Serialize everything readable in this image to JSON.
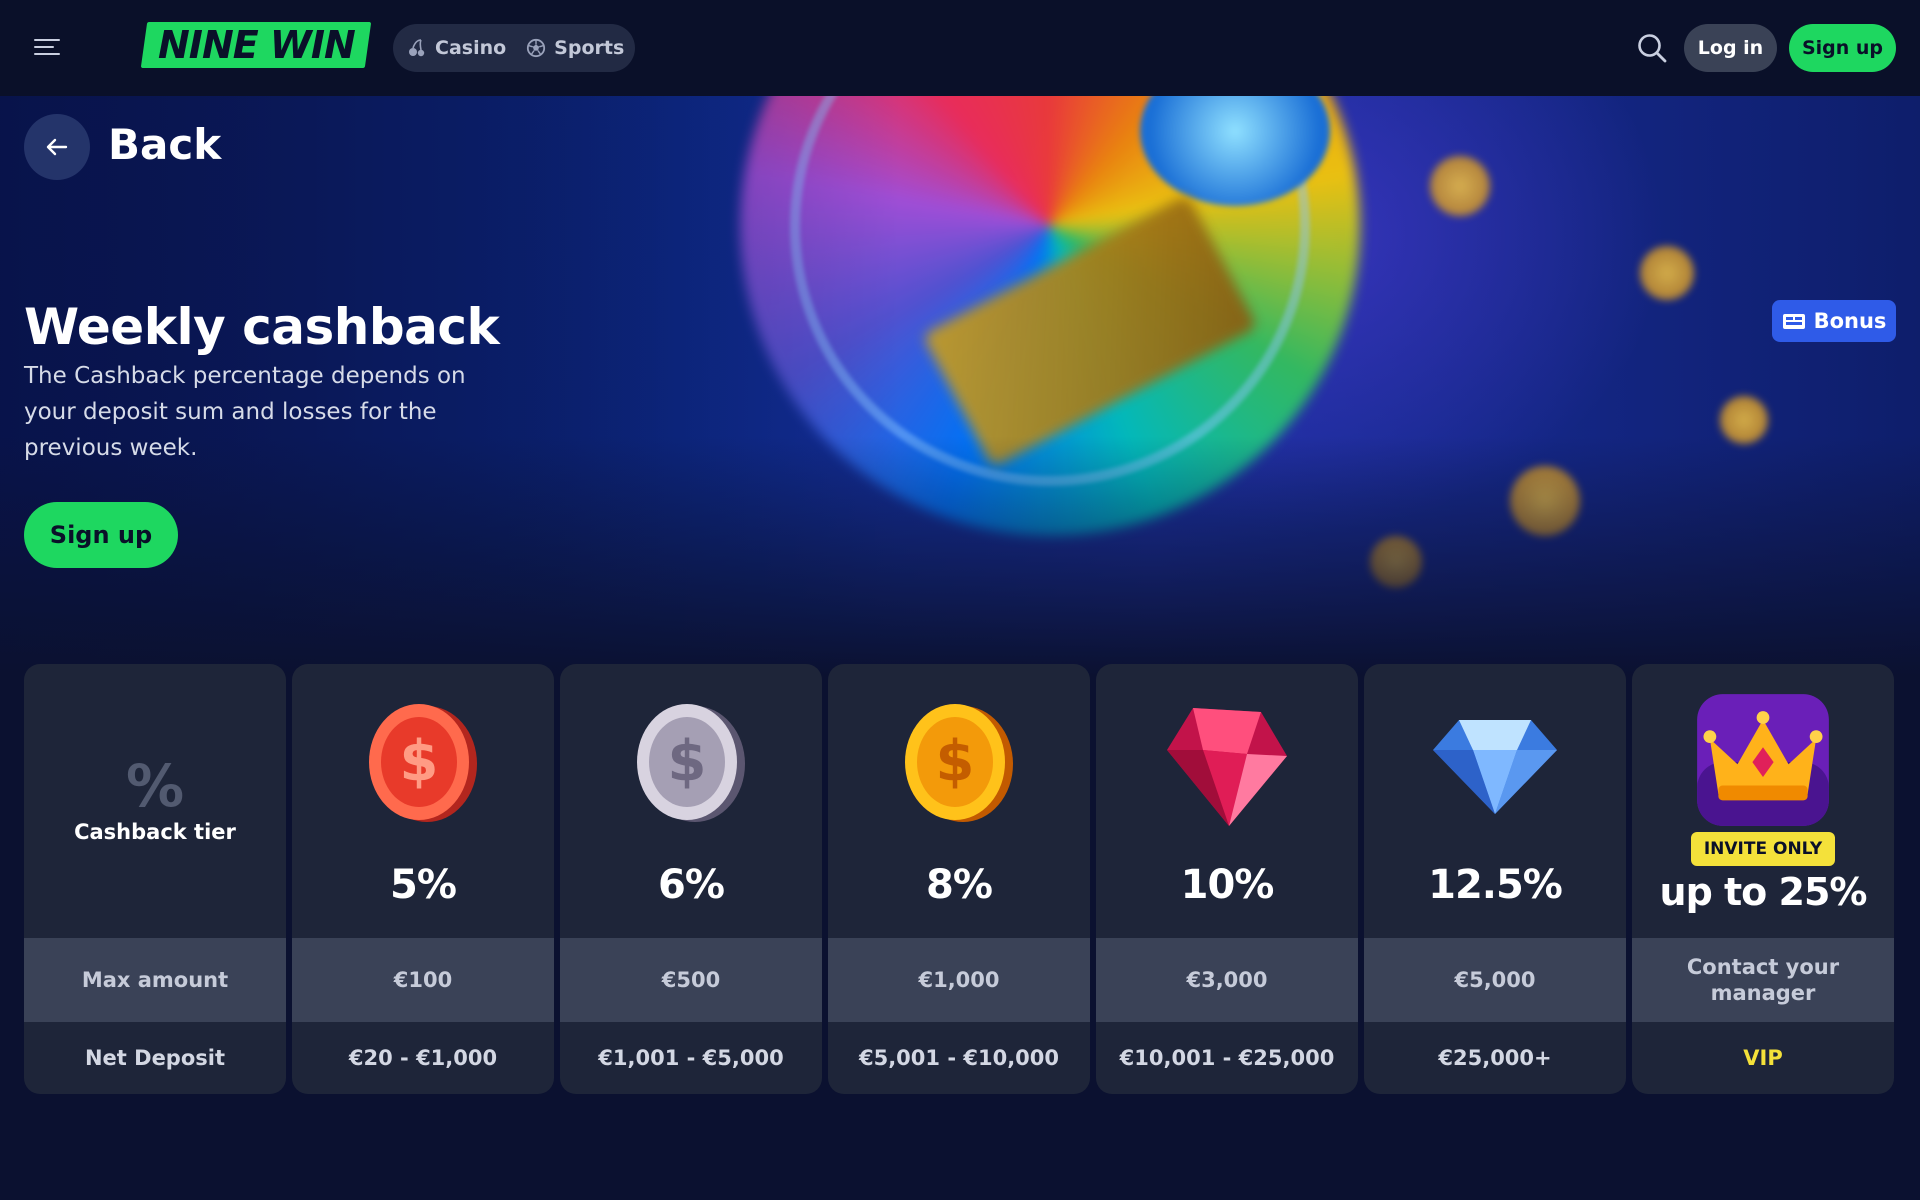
{
  "header": {
    "brand": "NINE WIN",
    "modes": [
      {
        "label": "Casino",
        "icon": "cherry-icon"
      },
      {
        "label": "Sports",
        "icon": "soccer-ball-icon"
      }
    ],
    "login_label": "Log in",
    "signup_label": "Sign up"
  },
  "hero": {
    "back_label": "Back",
    "title": "Weekly cashback",
    "description": "The Cashback percentage depends on your deposit sum and losses for the previous week.",
    "signup_label": "Sign up",
    "tag_label": "Bonus"
  },
  "tiers": {
    "header_label": "Cashback tier",
    "header_symbol": "%",
    "max_amount_label": "Max amount",
    "net_deposit_label": "Net Deposit",
    "items": [
      {
        "icon": "red-coin-icon",
        "percent": "5%",
        "max_amount": "€100",
        "net_deposit": "€20 - €1,000"
      },
      {
        "icon": "silver-coin-icon",
        "percent": "6%",
        "max_amount": "€500",
        "net_deposit": "€1,001 - €5,000"
      },
      {
        "icon": "gold-coin-icon",
        "percent": "8%",
        "max_amount": "€1,000",
        "net_deposit": "€5,001 - €10,000"
      },
      {
        "icon": "ruby-gem-icon",
        "percent": "10%",
        "max_amount": "€3,000",
        "net_deposit": "€10,001 - €25,000"
      },
      {
        "icon": "diamond-icon",
        "percent": "12.5%",
        "max_amount": "€5,000",
        "net_deposit": "€25,000+"
      },
      {
        "icon": "crown-icon",
        "badge": "INVITE ONLY",
        "percent": "up to 25%",
        "max_amount": "Contact your manager",
        "net_deposit": "VIP"
      }
    ]
  },
  "colors": {
    "accent": "#1ed760",
    "vip": "#f4e13a",
    "bonus_tag": "#2f5be8",
    "background": "#0b1130"
  }
}
